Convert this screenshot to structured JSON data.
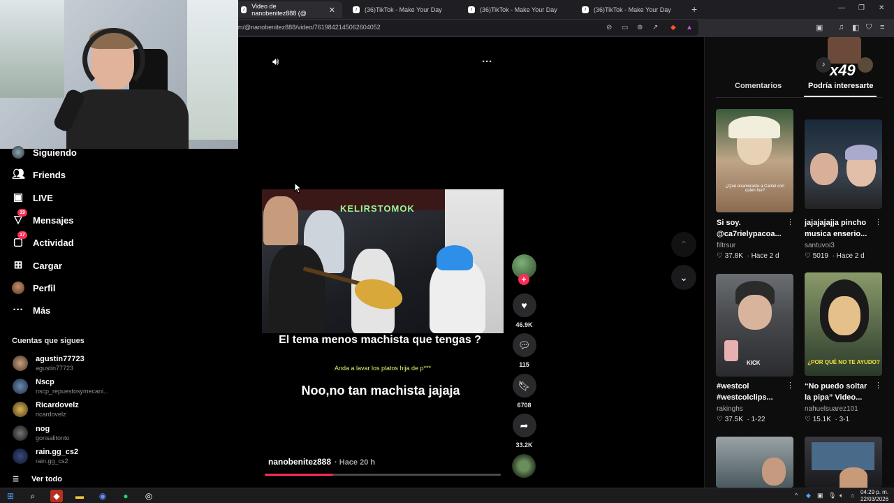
{
  "browser": {
    "tabs": [
      {
        "label": "Video de nanobenitez888 (@",
        "active": true
      },
      {
        "label": "(36)TikTok - Make Your Day",
        "active": false
      },
      {
        "label": "(36)TikTok - Make Your Day",
        "active": false
      },
      {
        "label": "(36)TikTok - Make Your Day",
        "active": false
      }
    ],
    "new_tab": "+",
    "url": "m/@nanobenitez888/video/7619842145062604052"
  },
  "sidebar": {
    "items": [
      {
        "label": "Siguiendo",
        "icon": "avatar-icon",
        "badge": ""
      },
      {
        "label": "Friends",
        "icon": "friends-icon",
        "badge": ""
      },
      {
        "label": "LIVE",
        "icon": "live-icon",
        "badge": ""
      },
      {
        "label": "Mensajes",
        "icon": "inbox-icon",
        "badge": "19"
      },
      {
        "label": "Actividad",
        "icon": "activity-icon",
        "badge": "17"
      },
      {
        "label": "Cargar",
        "icon": "upload-icon",
        "badge": ""
      },
      {
        "label": "Perfil",
        "icon": "profile-avatar-icon",
        "badge": ""
      },
      {
        "label": "Más",
        "icon": "more-icon",
        "badge": ""
      }
    ],
    "following_title": "Cuentas que sigues",
    "following": [
      {
        "name": "agustin77723",
        "handle": "agustin77723"
      },
      {
        "name": "Nscp",
        "handle": "nscp_repuestosymecani..."
      },
      {
        "name": "Ricardovelz",
        "handle": "ricardovelz"
      },
      {
        "name": "nog",
        "handle": "gonsalitonto"
      },
      {
        "name": "rain.gg_cs2",
        "handle": "rain.gg_cs2"
      }
    ],
    "see_all": "Ver todo"
  },
  "video": {
    "overlay_neon": "KELIRSTOMOK",
    "caption_main": "El tema menos machista que tengas ?",
    "caption_sub": "Anda a lavar los platos hija de p***",
    "caption_reply": "Noo,no tan machista jajaja",
    "author": "nanobenitez888",
    "time": "· Hace 20 h",
    "progress": 0.29
  },
  "actions": {
    "likes": "46.9K",
    "comments": "115",
    "saves": "6708",
    "shares": "33.2K"
  },
  "right_panel": {
    "emote": "x49",
    "tab_comments": "Comentarios",
    "tab_interesting": "Podría interesarte",
    "cards": [
      {
        "title": "Si soy. @ca7rielypacoa...",
        "author": "filtrsur",
        "likes": "37.8K",
        "date": "Hace 2 d",
        "overlay": "¿Qué enamoraste a Catriel con quién fue?"
      },
      {
        "title": "jajajajajja pincho musica enserio...",
        "author": "santuvoi3",
        "likes": "5019",
        "date": "Hace 2 d",
        "overlay": ""
      },
      {
        "title": "#westcol #westcolclips...",
        "author": "rakinghs",
        "likes": "37.5K",
        "date": "1-22",
        "overlay": "KICK"
      },
      {
        "title": "“No puedo soltar la pipa” Video...",
        "author": "nahuelsuarez101",
        "likes": "15.1K",
        "date": "3-1",
        "overlay": "¿POR QUÉ NO TE AYUDO?"
      }
    ]
  },
  "taskbar": {
    "time": "04:29 p. m.",
    "date": "22/03/2026"
  },
  "colors": {
    "accent": "#fe2c55",
    "background": "#000000",
    "caption_yellow": "#e8f26a"
  }
}
